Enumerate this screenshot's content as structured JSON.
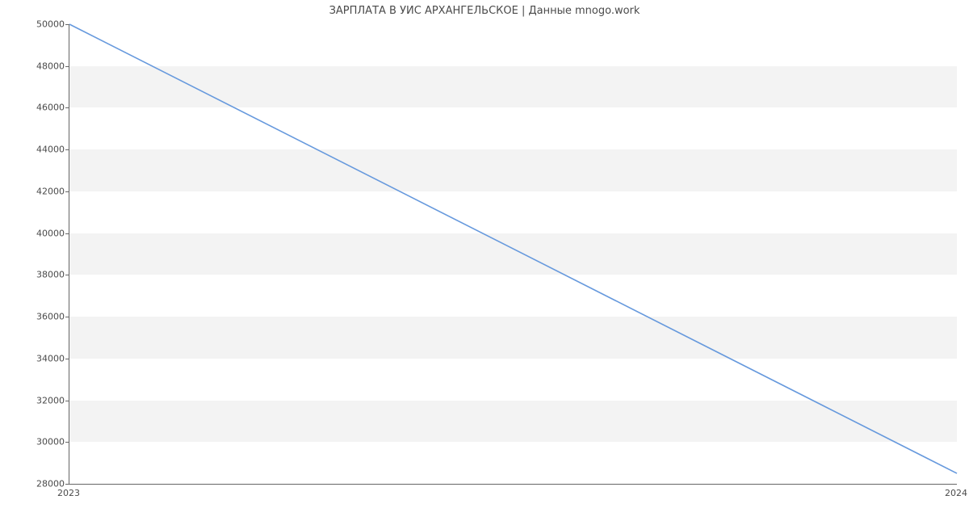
{
  "chart_data": {
    "type": "line",
    "title": "ЗАРПЛАТА В УИС АРХАНГЕЛЬСКОЕ | Данные mnogo.work",
    "xlabel": "",
    "ylabel": "",
    "x": [
      2023,
      2024
    ],
    "values": [
      50000,
      28500
    ],
    "xticks": [
      2023,
      2024
    ],
    "yticks": [
      28000,
      30000,
      32000,
      34000,
      36000,
      38000,
      40000,
      42000,
      44000,
      46000,
      48000,
      50000
    ],
    "ylim": [
      28000,
      50000
    ],
    "xlim": [
      2023,
      2024
    ],
    "line_color": "#6699dd",
    "band_color": "#f3f3f3"
  }
}
